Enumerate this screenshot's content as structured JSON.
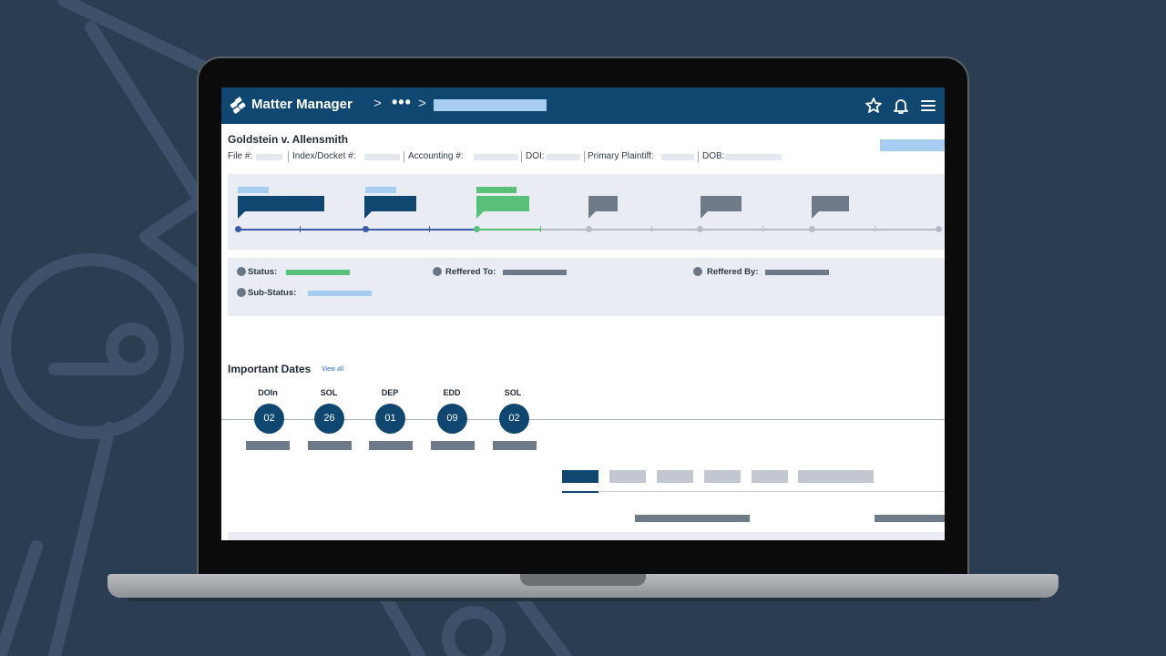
{
  "colors": {
    "background": "#2b3d51",
    "header": "#0f4770",
    "accent_light_blue": "#a7cdf0",
    "accent_green": "#59c07a",
    "panel": "#e9ecf3",
    "placeholder_gray": "#6e7a88"
  },
  "header": {
    "app_title": "Matter Manager",
    "breadcrumb_sep": ">",
    "breadcrumb_more": "•••",
    "icons": [
      "logo-icon",
      "star-icon",
      "bell-icon",
      "menu-icon"
    ]
  },
  "matter": {
    "title": "Goldstein v. Allensmith",
    "fields": [
      {
        "label": "File #:"
      },
      {
        "label": "Index/Docket #:"
      },
      {
        "label": "Accounting #:"
      },
      {
        "label": "DOI:"
      },
      {
        "label": "Primary Plaintiff:"
      },
      {
        "label": "DOB:"
      }
    ]
  },
  "status": {
    "status_label": "Status:",
    "sub_status_label": "Sub-Status:",
    "referred_to_label": "Reffered To:",
    "referred_by_label": "Reffered By:"
  },
  "important_dates": {
    "title": "Important Dates",
    "view_all": "View all",
    "items": [
      {
        "label": "DOIn",
        "value": "02"
      },
      {
        "label": "SOL",
        "value": "26"
      },
      {
        "label": "DEP",
        "value": "01"
      },
      {
        "label": "EDD",
        "value": "09"
      },
      {
        "label": "SOL",
        "value": "02"
      }
    ]
  }
}
